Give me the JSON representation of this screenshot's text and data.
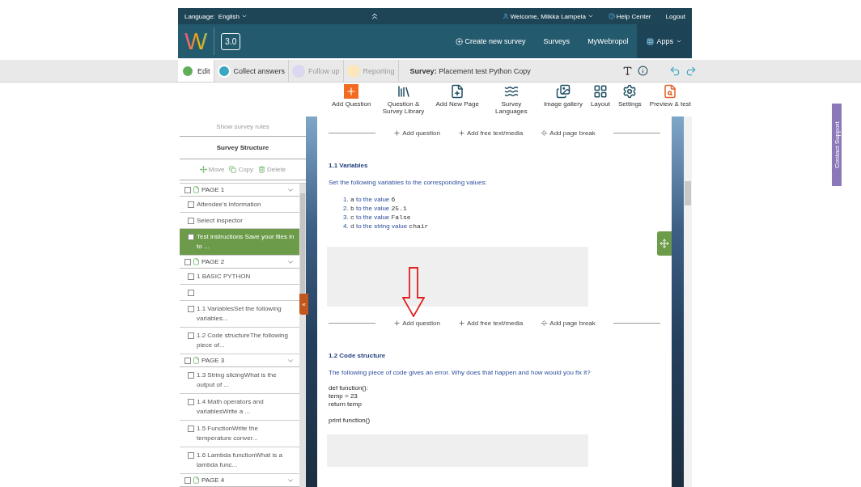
{
  "topbar": {
    "language_label": "Language:",
    "language": "English",
    "welcome": "Welcome, Miikka Lampela",
    "help": "Help Center",
    "logout": "Logout"
  },
  "header": {
    "logo": "W",
    "version": "3.0",
    "nav": [
      {
        "label": "Create new survey",
        "kind": "create"
      },
      {
        "label": "Surveys",
        "kind": "link"
      },
      {
        "label": "MyWebropol",
        "kind": "link"
      },
      {
        "label": "Apps",
        "kind": "apps"
      }
    ]
  },
  "modes": {
    "tabs": [
      {
        "label": "Edit",
        "selected": true,
        "disabled": false,
        "color": "#5fae5a"
      },
      {
        "label": "Collect answers",
        "selected": false,
        "disabled": false,
        "color": "#3aa7c4"
      },
      {
        "label": "Follow up",
        "selected": false,
        "disabled": true,
        "color": "#dcd7f0"
      },
      {
        "label": "Reporting",
        "selected": false,
        "disabled": true,
        "color": "#fbe7bb"
      }
    ],
    "survey_label": "Survey:",
    "survey_name": "Placement test Python Copy"
  },
  "toolbar": [
    {
      "label": "Add Question",
      "kind": "add"
    },
    {
      "label": "Question & Survey Library",
      "kind": "library"
    },
    {
      "label": "Add New Page",
      "kind": "page"
    },
    {
      "label": "Survey Languages",
      "kind": "languages"
    },
    {
      "label": "Image gallery",
      "kind": "gallery"
    },
    {
      "label": "Layout",
      "kind": "layout"
    },
    {
      "label": "Settings",
      "kind": "settings"
    },
    {
      "label": "Preview & test",
      "kind": "preview"
    }
  ],
  "sidebar": {
    "show_rules": "Show survey rules",
    "title": "Survey Structure",
    "actions": [
      {
        "label": "Move",
        "kind": "move"
      },
      {
        "label": "Copy",
        "kind": "copy"
      },
      {
        "label": "Delete",
        "kind": "delete"
      }
    ],
    "collapse": "«",
    "pages": [
      {
        "label": "PAGE  1",
        "checked": false,
        "expanded": true,
        "children": [
          {
            "label": "Attendee's information",
            "selected": false
          },
          {
            "label": "Select inspector",
            "selected": false
          },
          {
            "label": "Test instructions Save your files in to ...",
            "selected": true
          }
        ]
      },
      {
        "label": "PAGE  2",
        "checked": false,
        "expanded": true,
        "children": [
          {
            "label": "1 BASIC PYTHON",
            "selected": false
          },
          {
            "selected": false
          },
          {
            "label": "1.1 VariablesSet the following variables...",
            "selected": false
          },
          {
            "label": "1.2 Code structureThe following piece of...",
            "selected": false
          }
        ]
      },
      {
        "label": "PAGE  3",
        "checked": false,
        "expanded": true,
        "children": [
          {
            "label": "1.3 String slicingWhat is the output of ...",
            "selected": false
          },
          {
            "label": "1.4 Math operators and variablesWrite a ...",
            "selected": false
          },
          {
            "label": "1.5 FunctionWrite the temperature conver...",
            "selected": false
          },
          {
            "label": "1.6 Lambda functionWhat is a lambda func...",
            "selected": false
          }
        ]
      },
      {
        "label": "PAGE  4",
        "checked": false,
        "expanded": true
      }
    ]
  },
  "content": [
    {
      "kind": "addbar",
      "items": [
        {
          "label": "Add question",
          "kind": "plus"
        },
        {
          "label": "Add free text/media",
          "kind": "plus"
        },
        {
          "label": "Add page break",
          "kind": "break"
        }
      ]
    },
    {
      "kind": "question",
      "title": "1.1 Variables",
      "text": "Set the following variables to the corresponding values:",
      "list": [
        {
          "num": "1.",
          "var": "a",
          "text": "to the value",
          "value": "6"
        },
        {
          "num": "2.",
          "var": "b",
          "text": "to the value",
          "value": "25.1"
        },
        {
          "num": "3.",
          "var": "c",
          "text": "to the value",
          "value": "False"
        },
        {
          "num": "4.",
          "var": "d",
          "text": "to the string value",
          "value": "chair"
        }
      ]
    },
    {
      "kind": "addbar",
      "items": [
        {
          "label": "Add question",
          "kind": "plus"
        },
        {
          "label": "Add free text/media",
          "kind": "plus"
        },
        {
          "label": "Add page break",
          "kind": "break"
        }
      ]
    },
    {
      "kind": "question",
      "title": "1.2 Code structure",
      "text": "The following piece of code gives an error. Why does that happen and how would you fix it?",
      "code": [
        "def function():",
        "temp = 23",
        "return temp"
      ],
      "code_after": "print function()"
    }
  ],
  "support": "Contact Support"
}
